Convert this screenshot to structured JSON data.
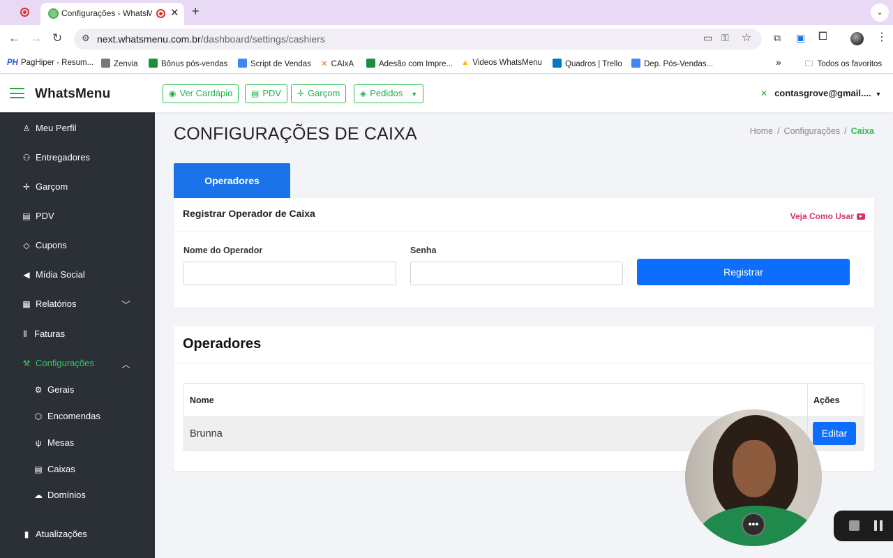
{
  "browser": {
    "tab_title": "Configurações - WhatsMenu",
    "tab_close": "✕",
    "new_tab": "+",
    "url_host": "next.whatsmenu.com.br",
    "url_path": "/dashboard/settings/cashiers",
    "bookmarks": [
      {
        "label": "PagHiper - Resum...",
        "icon": "paghiper-icon",
        "color": "#1a56db"
      },
      {
        "label": "Zenvia",
        "icon": "zenvia-icon",
        "color": "#555555"
      },
      {
        "label": "Bônus pós-vendas",
        "icon": "sheets-icon",
        "color": "#1e8e3e"
      },
      {
        "label": "Script de Vendas",
        "icon": "docs-icon",
        "color": "#4285f4"
      },
      {
        "label": "CAIxA",
        "icon": "caixa-icon",
        "color": "#f57c00"
      },
      {
        "label": "Adesão com Impre...",
        "icon": "sheets-icon",
        "color": "#1e8e3e"
      },
      {
        "label": "Videos WhatsMenu",
        "icon": "drive-icon",
        "color": "#fbbc04"
      },
      {
        "label": "Quadros | Trello",
        "icon": "trello-icon",
        "color": "#0079bf"
      },
      {
        "label": "Dep. Pós-Vendas...",
        "icon": "docs-icon",
        "color": "#4285f4"
      }
    ],
    "bookmarks_more": "»",
    "all_bookmarks": "Todos os favoritos"
  },
  "header": {
    "brand": "WhatsMenu",
    "buttons": [
      {
        "label": "Ver Cardápio",
        "icon": "eye-icon"
      },
      {
        "label": "PDV",
        "icon": "register-icon"
      },
      {
        "label": "Garçom",
        "icon": "waiter-icon"
      },
      {
        "label": "Pedidos",
        "icon": "tag-icon"
      }
    ],
    "user_email": "contasgrove@gmail....",
    "accent": "#28c04a"
  },
  "sidebar": {
    "items": [
      {
        "label": "Meu Perfil",
        "icon": "user-icon"
      },
      {
        "label": "Entregadores",
        "icon": "motorcycle-icon"
      },
      {
        "label": "Garçom",
        "icon": "waiter-icon"
      },
      {
        "label": "PDV",
        "icon": "register-icon"
      },
      {
        "label": "Cupons",
        "icon": "coupon-icon"
      },
      {
        "label": "Mídia Social",
        "icon": "megaphone-icon"
      },
      {
        "label": "Relatórios",
        "icon": "report-icon"
      },
      {
        "label": "Faturas",
        "icon": "barcode-icon"
      },
      {
        "label": "Configurações",
        "icon": "wrench-icon"
      }
    ],
    "subitems": [
      {
        "label": "Gerais",
        "icon": "gear-icon"
      },
      {
        "label": "Encomendas",
        "icon": "box-icon"
      },
      {
        "label": "Mesas",
        "icon": "cutlery-icon"
      },
      {
        "label": "Caixas",
        "icon": "cash-register-icon"
      },
      {
        "label": "Domínios",
        "icon": "cloud-icon"
      }
    ],
    "footer_item": {
      "label": "Atualizações",
      "icon": "document-icon"
    },
    "active_color": "#2bd05a"
  },
  "main": {
    "title": "CONFIGURAÇÕES DE CAIXA",
    "breadcrumb": [
      "Home",
      "Configurações",
      "Caixa"
    ],
    "tab": "Operadores",
    "form": {
      "title": "Registrar Operador de Caixa",
      "help_link": "Veja Como Usar",
      "name_label": "Nome do Operador",
      "name_value": "",
      "password_label": "Senha",
      "password_value": "",
      "submit": "Registrar"
    },
    "operators": {
      "title": "Operadores",
      "columns": [
        "Nome",
        "Ações"
      ],
      "rows": [
        {
          "name": "Brunna",
          "action": "Editar"
        }
      ]
    }
  },
  "overlay": {
    "webcam_menu": "•••"
  }
}
